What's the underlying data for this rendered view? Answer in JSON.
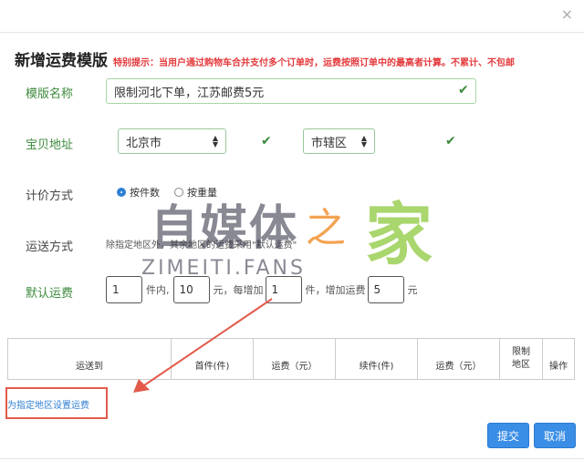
{
  "dialog": {
    "close_icon": "×",
    "title": "新增运费模版",
    "hint": "特别提示：当用户通过购物车合并支付多个订单时，运费按照订单中的最高者计算。不累计、不包邮"
  },
  "form": {
    "template_name_label": "模版名称",
    "template_name_value": "限制河北下单，江苏邮费5元",
    "origin_label": "宝贝地址",
    "province": "北京市",
    "district": "市辖区",
    "pricing_label": "计价方式",
    "pricing_options": [
      "按件数",
      "按重量"
    ],
    "pricing_selected": "按件数",
    "shipping_label": "运送方式",
    "shipping_note": "除指定地区外，其余地区的运费采用\"默认运费\"",
    "default_fee_label": "默认运费",
    "fee": {
      "first_count": "1",
      "text1": "件内,",
      "first_fee": "10",
      "text2": "元，每增加",
      "add_count": "1",
      "text3": "件，增加运费",
      "add_fee": "5",
      "text4": "元"
    }
  },
  "table": {
    "headers": [
      "运送到",
      "首件(件)",
      "运费（元）",
      "续件(件)",
      "运费（元）",
      "限制地区",
      "操作"
    ]
  },
  "link_text": "为指定地区设置运费",
  "buttons": {
    "submit": "提交",
    "cancel": "取消"
  },
  "watermark": {
    "cn": "自媒体",
    "zhi": "之",
    "jia": "家",
    "en": "ZIMEITI.FANS"
  },
  "colors": {
    "accent": "#3a8ee6",
    "green": "#3c8a3c",
    "hint_red": "#e4393c",
    "annotation_red": "#e35a4a"
  }
}
